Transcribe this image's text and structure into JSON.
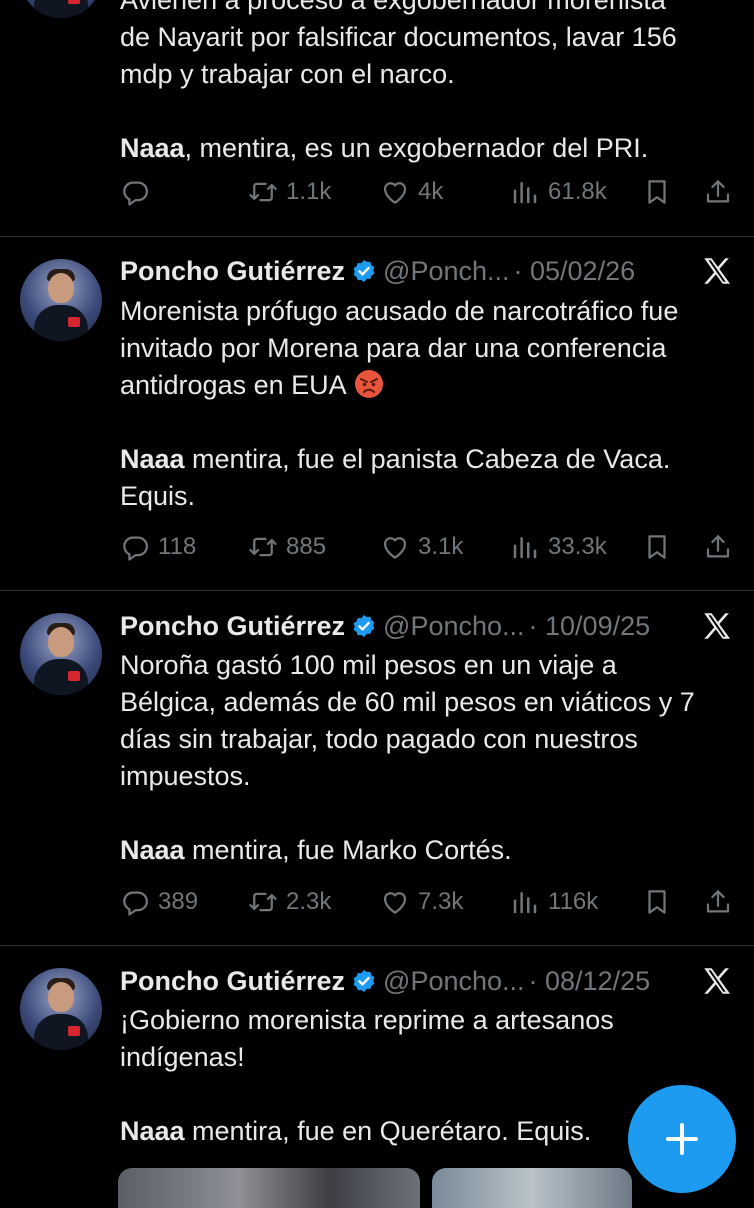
{
  "tweets": [
    {
      "partial_line": "Avienen a proceso a exgobernador morenista",
      "lines": [
        "de Nayarit por falsificar documentos, lavar 156",
        "mdp y trabajar con el narco."
      ],
      "punch_bold": "Naaa",
      "punch_rest": ", mentira, es un exgobernador del PRI.",
      "replies": "",
      "retweets": "1.1k",
      "likes": "4k",
      "views": "61.8k"
    },
    {
      "name": "Poncho Gutiérrez",
      "handle": "@Ponch...",
      "date": "· 05/02/26",
      "lines": [
        "Morenista prófugo acusado de narcotráfico fue",
        "invitado por Morena para dar una conferencia",
        "antidrogas en EUA"
      ],
      "emoji": "angry-face",
      "punch_bold": "Naaa",
      "punch_rest": " mentira, fue el panista Cabeza de Vaca.",
      "punch_line2": "Equis.",
      "replies": "118",
      "retweets": "885",
      "likes": "3.1k",
      "views": "33.3k"
    },
    {
      "name": "Poncho Gutiérrez",
      "handle": "@Poncho...",
      "date": "· 10/09/25",
      "lines": [
        "Noroña gastó 100 mil pesos en un viaje a",
        "Bélgica, además de 60 mil pesos en viáticos y 7",
        "días sin trabajar, todo pagado con nuestros",
        "impuestos."
      ],
      "punch_bold": "Naaa",
      "punch_rest": " mentira, fue Marko Cortés.",
      "replies": "389",
      "retweets": "2.3k",
      "likes": "7.3k",
      "views": "116k"
    },
    {
      "name": "Poncho Gutiérrez",
      "handle": "@Poncho...",
      "date": "· 08/12/25",
      "lines": [
        "¡Gobierno morenista reprime a artesanos",
        "indígenas!"
      ],
      "punch_bold": "Naaa",
      "punch_rest": " mentira, fue en Querétaro. Equis."
    }
  ],
  "icons": {
    "reply": "reply-icon",
    "retweet": "retweet-icon",
    "like": "heart-icon",
    "views": "views-icon",
    "bookmark": "bookmark-icon",
    "share": "share-icon",
    "verified": "verified-badge-icon",
    "x": "x-logo-icon",
    "compose": "plus-icon"
  },
  "colors": {
    "background": "#000000",
    "text": "#e7e9ea",
    "muted": "#71767b",
    "accent": "#1d9bf0",
    "divider": "#2f3336"
  }
}
